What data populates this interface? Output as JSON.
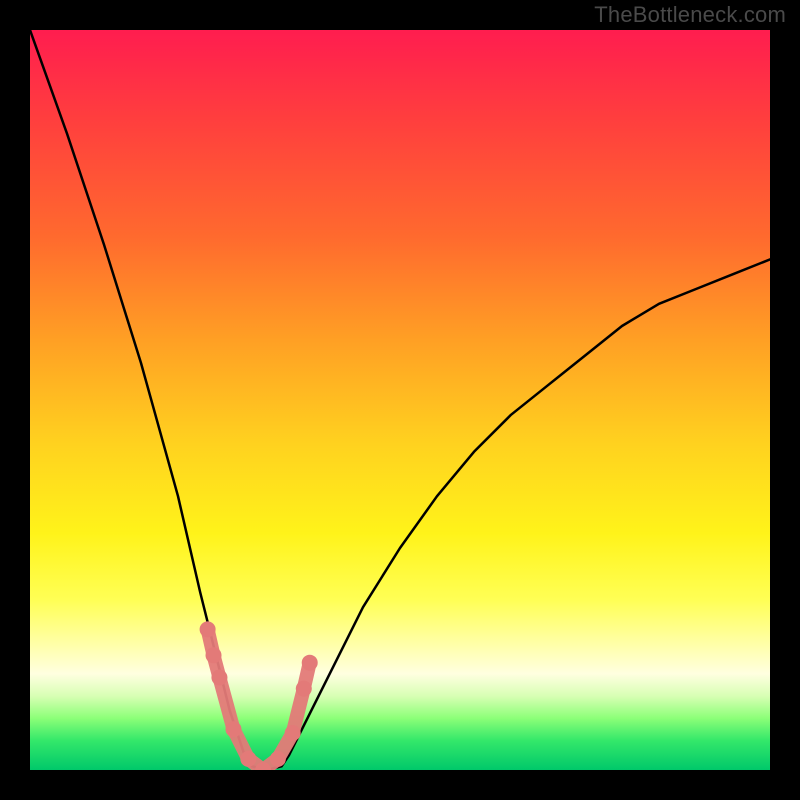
{
  "watermark": "TheBottleneck.com",
  "chart_data": {
    "type": "line",
    "title": "",
    "xlabel": "",
    "ylabel": "",
    "x_range": [
      0,
      100
    ],
    "y_range": [
      0,
      100
    ],
    "grid": false,
    "legend": false,
    "description": "Bottleneck curve: percentage mismatch (y) versus component balance (x). Curve drops from ~100% at x≈0 to a minimum near ~0% around x≈29–35, then rises toward ~69% at x=100. Background gradient encodes severity (red=high mismatch at top, green=low at bottom).",
    "series": [
      {
        "name": "bottleneck-curve",
        "color": "#000000",
        "x": [
          0,
          5,
          10,
          15,
          20,
          23,
          25,
          27,
          29,
          30,
          32,
          34,
          35,
          37,
          40,
          45,
          50,
          55,
          60,
          65,
          70,
          75,
          80,
          85,
          90,
          95,
          100
        ],
        "y": [
          100,
          86,
          71,
          55,
          37,
          24,
          16,
          8,
          2,
          0.5,
          0,
          0.5,
          2,
          6,
          12,
          22,
          30,
          37,
          43,
          48,
          52,
          56,
          60,
          63,
          65,
          67,
          69
        ]
      }
    ],
    "markers": {
      "name": "highlight-dots",
      "color": "#e37a78",
      "x": [
        24.0,
        24.8,
        25.6,
        27.5,
        29.5,
        31.5,
        33.5,
        35.5,
        37.0,
        37.8
      ],
      "y": [
        19.0,
        15.5,
        12.5,
        5.5,
        1.5,
        0.0,
        1.5,
        5.0,
        11.0,
        14.5
      ]
    },
    "gradient_stops": [
      {
        "pct": 0,
        "color": "#ff1d4f"
      },
      {
        "pct": 12,
        "color": "#ff3e3e"
      },
      {
        "pct": 28,
        "color": "#ff6a2e"
      },
      {
        "pct": 42,
        "color": "#ffa024"
      },
      {
        "pct": 56,
        "color": "#ffd21f"
      },
      {
        "pct": 68,
        "color": "#fff31a"
      },
      {
        "pct": 77,
        "color": "#ffff55"
      },
      {
        "pct": 83,
        "color": "#ffffa8"
      },
      {
        "pct": 87,
        "color": "#ffffe0"
      },
      {
        "pct": 90,
        "color": "#d8ffb4"
      },
      {
        "pct": 93,
        "color": "#8cff78"
      },
      {
        "pct": 96,
        "color": "#34e86a"
      },
      {
        "pct": 100,
        "color": "#00c86a"
      }
    ]
  }
}
